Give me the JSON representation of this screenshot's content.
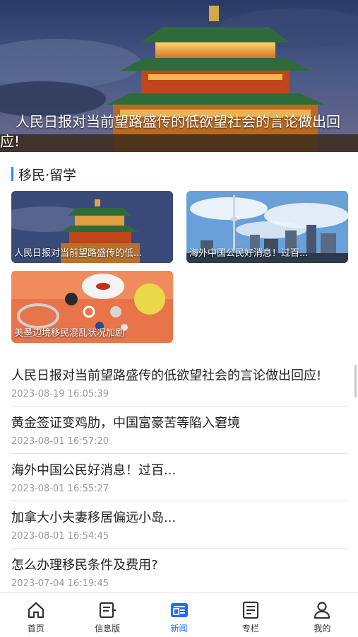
{
  "hero": {
    "caption_line1": "人民日报对当前望路盛传的低欲望社会的言论做出回",
    "caption_line2": "应!"
  },
  "section": {
    "title": "移民·留学"
  },
  "cards": [
    {
      "caption": "人民日报对当前望路盛传的低..."
    },
    {
      "caption": "海外中国公民好消息！过百..."
    },
    {
      "caption": "美墨边境移民混乱状况加剧"
    }
  ],
  "news": [
    {
      "title": "人民日报对当前望路盛传的低欲望社会的言论做出回应!",
      "date": "2023-08-19 16:05:39"
    },
    {
      "title": "黄金签证变鸡肋，中国富豪苦等陷入窘境",
      "date": "2023-08-01 16:57:20"
    },
    {
      "title": "海外中国公民好消息！过百...",
      "date": "2023-08-01 16:55:27"
    },
    {
      "title": "加拿大小夫妻移居偏远小岛...",
      "date": "2023-08-01 16:54:45"
    },
    {
      "title": "怎么办理移民条件及费用?",
      "date": "2023-07-04 16:19:45"
    }
  ],
  "nav": {
    "items": [
      {
        "label": "首页",
        "icon": "home-icon"
      },
      {
        "label": "信息版",
        "icon": "info-board-icon"
      },
      {
        "label": "新闻",
        "icon": "news-icon"
      },
      {
        "label": "专栏",
        "icon": "column-icon"
      },
      {
        "label": "我的",
        "icon": "user-icon"
      }
    ],
    "active_index": 2,
    "active_color": "#1e6fff",
    "inactive_color": "#333333"
  },
  "colors": {
    "accent": "#1e88ff"
  }
}
